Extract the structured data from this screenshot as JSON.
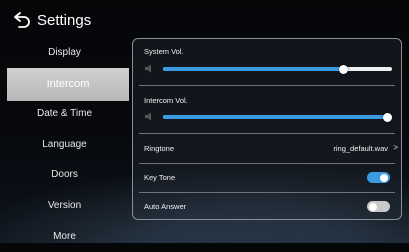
{
  "header": {
    "title": "Settings",
    "back_icon": "back-arrow-icon"
  },
  "sidebar": {
    "items": [
      {
        "label": "Display",
        "active": false
      },
      {
        "label": "Intercom",
        "active": true
      },
      {
        "label": "Date & Time",
        "active": false
      },
      {
        "label": "Language",
        "active": false
      },
      {
        "label": "Doors",
        "active": false
      },
      {
        "label": "Version",
        "active": false
      },
      {
        "label": "More",
        "active": false
      }
    ]
  },
  "settings": {
    "system_vol": {
      "label": "System Vol.",
      "level": 0.79
    },
    "intercom_vol": {
      "label": "Intercom Vol.",
      "level": 1.0
    },
    "ringtone": {
      "label": "Ringtone",
      "value": "ring_default.wav",
      "chevron": ">"
    },
    "key_tone": {
      "label": "Key Tone",
      "enabled": true
    },
    "auto_answer": {
      "label": "Auto Answer",
      "enabled": false
    }
  },
  "colors": {
    "accent": "#3a9be0",
    "active_tab": "#c4c4c4"
  }
}
